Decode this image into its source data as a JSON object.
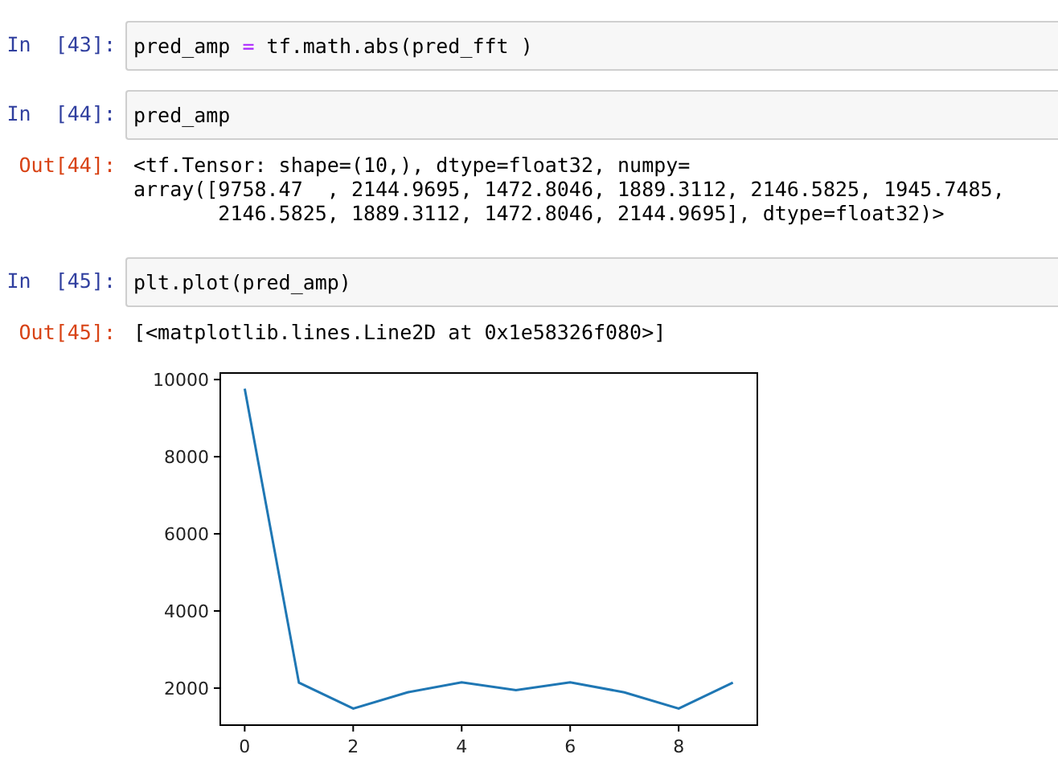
{
  "cells": [
    {
      "kind": "input",
      "prompt": "In  [43]:",
      "tokens": [
        {
          "text": "pred_amp ",
          "kind": "plain"
        },
        {
          "text": "=",
          "kind": "operator"
        },
        {
          "text": " tf.math.abs(pred_fft )",
          "kind": "plain"
        }
      ]
    },
    {
      "kind": "input",
      "prompt": "In  [44]:",
      "tokens": [
        {
          "text": "pred_amp",
          "kind": "plain"
        }
      ]
    },
    {
      "kind": "output",
      "prompt": "Out[44]:",
      "lines": [
        "<tf.Tensor: shape=(10,), dtype=float32, numpy=",
        "array([9758.47  , 2144.9695, 1472.8046, 1889.3112, 2146.5825, 1945.7485,",
        "       2146.5825, 1889.3112, 1472.8046, 2144.9695], dtype=float32)>"
      ]
    },
    {
      "kind": "input",
      "prompt": "In  [45]:",
      "tokens": [
        {
          "text": "plt.plot(pred_amp)",
          "kind": "plain"
        }
      ]
    },
    {
      "kind": "output",
      "prompt": "Out[45]:",
      "lines": [
        "[<matplotlib.lines.Line2D at 0x1e58326f080>]"
      ]
    },
    {
      "kind": "plot",
      "chart_data": {
        "type": "line",
        "x": [
          0,
          1,
          2,
          3,
          4,
          5,
          6,
          7,
          8,
          9
        ],
        "series": [
          {
            "color": "#1f77b4",
            "values": [
              9760,
              2140,
              1470,
              1890,
              2150,
              1950,
              2150,
              1890,
              1470,
              2140
            ]
          }
        ],
        "xlim": [
          -0.45,
          9.45
        ],
        "ylim": [
          1040,
          10170
        ],
        "xticks": [
          0,
          2,
          4,
          6,
          8
        ],
        "yticks": [
          2000,
          4000,
          6000,
          8000,
          10000
        ]
      }
    }
  ]
}
